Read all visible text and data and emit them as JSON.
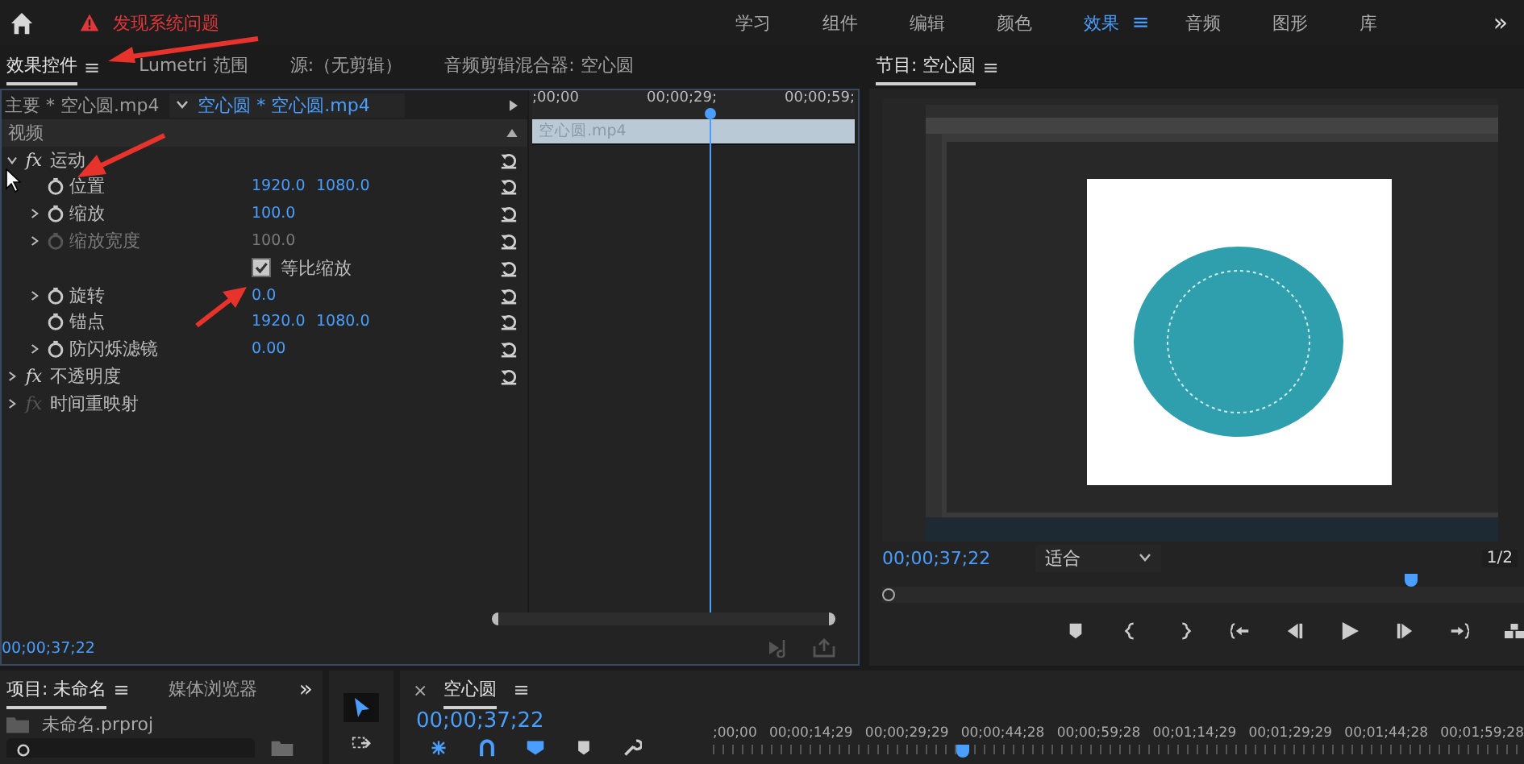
{
  "top_bar": {
    "alert": "发现系统问题",
    "workspaces": [
      {
        "label": "学习",
        "selected": false
      },
      {
        "label": "组件",
        "selected": false
      },
      {
        "label": "编辑",
        "selected": false
      },
      {
        "label": "颜色",
        "selected": false
      },
      {
        "label": "效果",
        "selected": true,
        "menu": "≡"
      },
      {
        "label": "音频",
        "selected": false
      },
      {
        "label": "图形",
        "selected": false
      },
      {
        "label": "库",
        "selected": false
      }
    ],
    "overflow": "»"
  },
  "effect_controls": {
    "tabs": [
      {
        "label": "效果控件",
        "selected": true,
        "menu": "≡"
      },
      {
        "label": "Lumetri 范围",
        "selected": false
      },
      {
        "label": "源:（无剪辑）",
        "selected": false
      },
      {
        "label": "音频剪辑混合器: 空心圆",
        "selected": false
      }
    ],
    "master_clip": "主要 * 空心圆.mp4",
    "sequence_clip": "空心圆 * 空心圆.mp4",
    "ruler": [
      ";00;00",
      "00;00;29;",
      "00;00;59;"
    ],
    "clip": "空心圆.mp4",
    "playhead": {
      "level": 0.55
    },
    "rows": [
      {
        "kind": "section",
        "label": "视频"
      },
      {
        "kind": "effect",
        "icon": "fx",
        "label": "运动",
        "expanded": true,
        "disabled": false
      },
      {
        "kind": "property",
        "label": "位置",
        "values": [
          "1920.0",
          "1080.0"
        ],
        "disabled": false
      },
      {
        "kind": "property",
        "label": "缩放",
        "expanded": false,
        "values": [
          "100.0"
        ],
        "disabled": false
      },
      {
        "kind": "property",
        "label": "缩放宽度",
        "expanded": false,
        "values": [
          "100.0"
        ],
        "disabled": true
      },
      {
        "kind": "checkbox",
        "label": "等比缩放",
        "checked": true
      },
      {
        "kind": "property",
        "label": "旋转",
        "expanded": false,
        "values": [
          "0.0"
        ],
        "disabled": false
      },
      {
        "kind": "property",
        "label": "锚点",
        "values": [
          "1920.0",
          "1080.0"
        ],
        "disabled": false
      },
      {
        "kind": "property",
        "label": "防闪烁滤镜",
        "expanded": false,
        "values": [
          "0.00"
        ],
        "disabled": false
      },
      {
        "kind": "effect",
        "icon": "fx",
        "label": "不透明度",
        "expanded": false,
        "disabled": false
      },
      {
        "kind": "effect",
        "icon": "fx",
        "label": "时间重映射",
        "expanded": false,
        "disabled": true
      }
    ],
    "timecode": "00;00;37;22"
  },
  "program_monitor": {
    "tab": {
      "label": "节目: 空心圆",
      "selected": true,
      "menu": "≡"
    },
    "timecode": "00;00;37;22",
    "zoom": "适合",
    "resolution": "1/2",
    "playhead": {
      "level": 0.815
    }
  },
  "project": {
    "tabs": [
      {
        "label": "项目: 未命名",
        "selected": true,
        "menu": "≡"
      },
      {
        "label": "媒体浏览器",
        "selected": false
      }
    ],
    "overflow": "»",
    "file": "未命名.prproj"
  },
  "tools": [
    {
      "kind": "selection",
      "selected": true
    },
    {
      "kind": "track-select",
      "selected": false
    }
  ],
  "timeline": {
    "close": "×",
    "title": "空心圆",
    "menu": "≡",
    "timecode": "00;00;37;22",
    "ruler": [
      ";00;00",
      "00;00;14;29",
      "00;00;29;29",
      "00;00;44;28",
      "00;00;59;28",
      "00;01;14;29",
      "00;01;29;29",
      "00;01;44;28",
      "00;01;59;28"
    ],
    "playhead": {
      "level": 0.3
    }
  }
}
